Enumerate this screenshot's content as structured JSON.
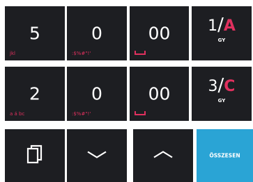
{
  "row1": {
    "key1": {
      "main": "5",
      "sub": "jkl"
    },
    "key2": {
      "main": "0",
      "sub": ":$%#\"!'"
    },
    "key3": {
      "main": "00"
    },
    "key4": {
      "num": "1",
      "sep": "/",
      "letter": "A",
      "sub": "GY"
    }
  },
  "row2": {
    "key1": {
      "main": "2",
      "sub": "a á bc"
    },
    "key2": {
      "main": "0",
      "sub": ":$%#\"!'"
    },
    "key3": {
      "main": "00"
    },
    "key4": {
      "num": "3",
      "sep": "/",
      "letter": "C",
      "sub": "GY"
    }
  },
  "row3": {
    "total_label": "ÖSSZESEN"
  },
  "icons": {
    "space": "space-icon",
    "copy": "copy-icon",
    "down": "chevron-down-icon",
    "up": "chevron-up-icon"
  },
  "colors": {
    "key_background": "#1d1e22",
    "accent": "#e0305e",
    "total_background": "#2aa4d5"
  }
}
